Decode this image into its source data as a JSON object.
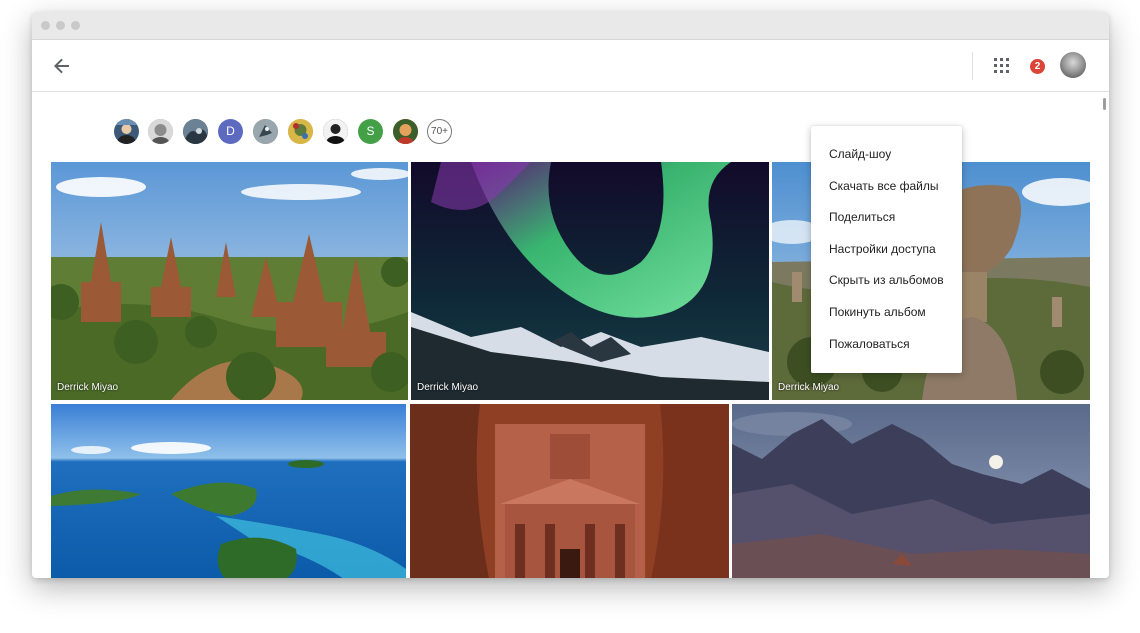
{
  "window": {
    "traffic_lights": 3
  },
  "appbar": {
    "back_icon": "arrow-left-icon",
    "apps_icon": "apps-grid-icon",
    "notification_count": "2",
    "notification_color": "#db4437",
    "avatar_icon": "account-avatar"
  },
  "contributors": {
    "avatars": [
      {
        "type": "photo",
        "initial": "",
        "color": "#3c5a78"
      },
      {
        "type": "photo",
        "initial": "",
        "color": "#8a8a8a"
      },
      {
        "type": "photo",
        "initial": "",
        "color": "#2f3f4e"
      },
      {
        "type": "letter",
        "initial": "D",
        "color": "#5c6bc0"
      },
      {
        "type": "photo",
        "initial": "",
        "color": "#6d7b86"
      },
      {
        "type": "photo",
        "initial": "",
        "color": "#c0a040"
      },
      {
        "type": "photo",
        "initial": "",
        "color": "#333333"
      },
      {
        "type": "letter",
        "initial": "S",
        "color": "#43a047"
      },
      {
        "type": "photo",
        "initial": "",
        "color": "#b86a2a"
      }
    ],
    "more_label": "70+"
  },
  "photos": {
    "row1": [
      {
        "subject": "Bagan temples",
        "credit": "Derrick Miyao"
      },
      {
        "subject": "Aurora borealis",
        "credit": "Derrick Miyao"
      },
      {
        "subject": "Balanced rock canyon",
        "credit": "Derrick Miyao"
      }
    ],
    "row2": [
      {
        "subject": "Tropical islands"
      },
      {
        "subject": "Petra treasury"
      },
      {
        "subject": "Moonrise over mountains"
      }
    ]
  },
  "menu": {
    "items": [
      "Слайд-шоу",
      "Скачать все файлы",
      "Поделиться",
      "Настройки доступа",
      "Скрыть из альбомов",
      "Покинуть альбом",
      "Пожаловаться"
    ]
  }
}
